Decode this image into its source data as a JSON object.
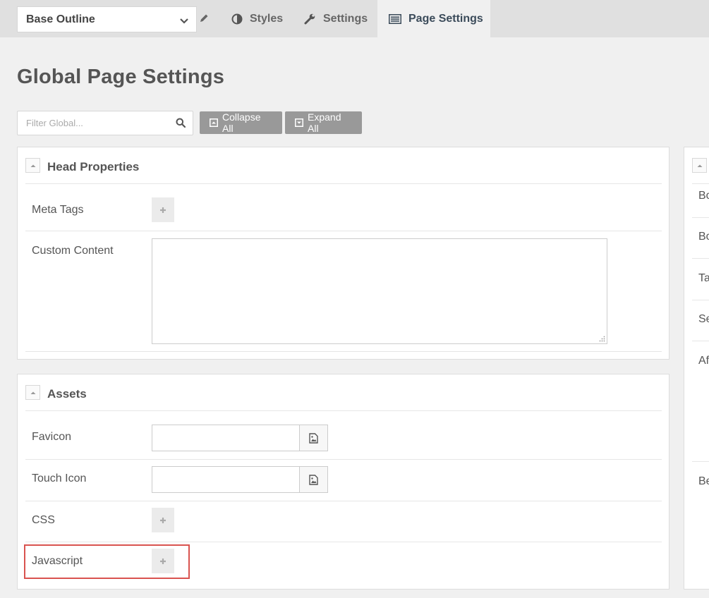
{
  "topbar": {
    "outline": "Base Outline",
    "tabs": [
      {
        "label": "Styles",
        "icon": "half-circle-icon"
      },
      {
        "label": "Settings",
        "icon": "wrench-icon"
      },
      {
        "label": "Page Settings",
        "icon": "list-icon",
        "active": true
      }
    ]
  },
  "page": {
    "title": "Global Page Settings"
  },
  "toolbar": {
    "filter_placeholder": "Filter Global...",
    "collapse_label": "Collapse All",
    "expand_label": "Expand All"
  },
  "head_properties": {
    "title": "Head Properties",
    "rows": [
      {
        "label": "Meta Tags"
      },
      {
        "label": "Custom Content"
      }
    ]
  },
  "assets": {
    "title": "Assets",
    "rows": [
      {
        "label": "Favicon"
      },
      {
        "label": "Touch Icon"
      },
      {
        "label": "CSS"
      },
      {
        "label": "Javascript"
      }
    ]
  },
  "right_panel": {
    "rows": [
      "Bo",
      "Bo",
      "Ta",
      "Se",
      "Af",
      "Be"
    ]
  },
  "colors": {
    "accent_dark": "#3b4b5a",
    "button_gray": "#999999",
    "highlight": "#d9534f"
  }
}
